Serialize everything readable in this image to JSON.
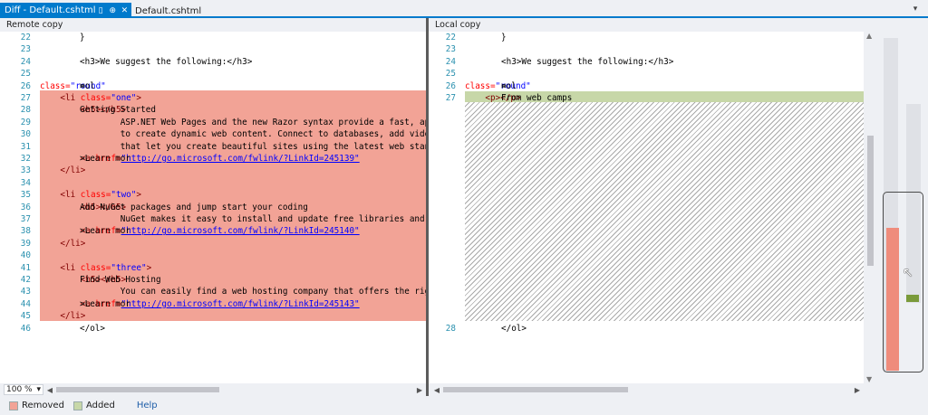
{
  "tabs": {
    "active": {
      "label": "Diff - Default.cshtml",
      "pin_icon": "pin-icon",
      "close_icon": "close-icon"
    },
    "inactive": {
      "label": "Default.cshtml"
    },
    "dropdown_icon": "chevron-down-icon"
  },
  "left_pane": {
    "header": "Remote copy",
    "lines": [
      {
        "n": "22",
        "segments": [
          [
            "}",
            "txt"
          ]
        ]
      },
      {
        "n": "23",
        "segments": []
      },
      {
        "n": "24",
        "segments": [
          [
            "<h3>We suggest the following:</h3>",
            "txt"
          ]
        ]
      },
      {
        "n": "25",
        "segments": []
      },
      {
        "n": "26",
        "segments": [
          [
            "<ol ",
            "txt"
          ],
          [
            "class=",
            "attr"
          ],
          [
            "\"round\"",
            "val"
          ],
          [
            ">",
            "txt"
          ]
        ]
      },
      {
        "n": "27",
        "segments": [
          [
            "    <li ",
            "tag"
          ],
          [
            "class=",
            "attr"
          ],
          [
            "\"one\"",
            "val"
          ],
          [
            ">",
            "tag"
          ]
        ]
      },
      {
        "n": "28",
        "segments": [
          [
            "        <h5>",
            "tag"
          ],
          [
            "Getting Started",
            "txt"
          ],
          [
            "</h5>",
            "tag"
          ]
        ]
      },
      {
        "n": "29",
        "segments": [
          [
            "        ASP.NET Web Pages and the new Razor syntax provide a fast, approa",
            "txt"
          ]
        ]
      },
      {
        "n": "30",
        "segments": [
          [
            "        to create dynamic web content. Connect to databases, add video, l",
            "txt"
          ]
        ]
      },
      {
        "n": "31",
        "segments": [
          [
            "        that let you create beautiful sites using the latest web standarc",
            "txt"
          ]
        ]
      },
      {
        "n": "32",
        "segments": [
          [
            "        <a ",
            "tag"
          ],
          [
            "href=",
            "attr"
          ],
          [
            "\"http://go.microsoft.com/fwlink/?LinkId=245139\"",
            "link"
          ],
          [
            ">Learn mor",
            "txt"
          ]
        ]
      },
      {
        "n": "33",
        "segments": [
          [
            "    </li>",
            "tag"
          ]
        ]
      },
      {
        "n": "34",
        "segments": []
      },
      {
        "n": "35",
        "segments": [
          [
            "    <li ",
            "tag"
          ],
          [
            "class=",
            "attr"
          ],
          [
            "\"two\"",
            "val"
          ],
          [
            ">",
            "tag"
          ]
        ]
      },
      {
        "n": "36",
        "segments": [
          [
            "        <h5>",
            "tag"
          ],
          [
            "Add NuGet packages and jump start your coding",
            "txt"
          ],
          [
            "</h5>",
            "tag"
          ]
        ]
      },
      {
        "n": "37",
        "segments": [
          [
            "        NuGet makes it easy to install and update free libraries and tool",
            "txt"
          ]
        ]
      },
      {
        "n": "38",
        "segments": [
          [
            "        <a ",
            "tag"
          ],
          [
            "href=",
            "attr"
          ],
          [
            "\"http://go.microsoft.com/fwlink/?LinkId=245140\"",
            "link"
          ],
          [
            ">Learn mor",
            "txt"
          ]
        ]
      },
      {
        "n": "39",
        "segments": [
          [
            "    </li>",
            "tag"
          ]
        ]
      },
      {
        "n": "40",
        "segments": []
      },
      {
        "n": "41",
        "segments": [
          [
            "    <li ",
            "tag"
          ],
          [
            "class=",
            "attr"
          ],
          [
            "\"three\"",
            "val"
          ],
          [
            ">",
            "tag"
          ]
        ]
      },
      {
        "n": "42",
        "segments": [
          [
            "        <h5>",
            "tag"
          ],
          [
            "Find Web Hosting",
            "txt"
          ],
          [
            "</h5>",
            "tag"
          ]
        ]
      },
      {
        "n": "43",
        "segments": [
          [
            "        You can easily find a web hosting company that offers the right m",
            "txt"
          ]
        ]
      },
      {
        "n": "44",
        "segments": [
          [
            "        <a ",
            "tag"
          ],
          [
            "href=",
            "attr"
          ],
          [
            "\"http://go.microsoft.com/fwlink/?LinkId=245143\"",
            "link"
          ],
          [
            ">Learn mor",
            "txt"
          ]
        ]
      },
      {
        "n": "45",
        "segments": [
          [
            "    </li>",
            "tag"
          ]
        ]
      },
      {
        "n": "46",
        "segments": [
          [
            "</ol>",
            "txt"
          ]
        ]
      }
    ]
  },
  "right_pane": {
    "header": "Local copy",
    "lines": [
      {
        "n": "22",
        "segments": [
          [
            "}",
            "txt"
          ]
        ]
      },
      {
        "n": "23",
        "segments": []
      },
      {
        "n": "24",
        "segments": [
          [
            "<h3>We suggest the following:</h3>",
            "txt"
          ]
        ]
      },
      {
        "n": "25",
        "segments": []
      },
      {
        "n": "26",
        "segments": [
          [
            "<ol ",
            "txt"
          ],
          [
            "class=",
            "attr"
          ],
          [
            "\"round\"",
            "val"
          ],
          [
            ">",
            "txt"
          ]
        ]
      },
      {
        "n": "27",
        "segments": [
          [
            "    <p>",
            "tag"
          ],
          [
            "From web camps",
            "txt"
          ],
          [
            "</p>",
            "tag"
          ]
        ]
      },
      {
        "n": "28",
        "segments": [
          [
            "</ol>",
            "txt"
          ]
        ]
      }
    ]
  },
  "status": {
    "zoom": "100 %",
    "zoom_icon": "chevron-down-icon"
  },
  "legend": {
    "removed": "Removed",
    "added": "Added",
    "help": "Help"
  },
  "colors": {
    "accent": "#007acc",
    "removed": "#f2a396",
    "added": "#c7d7a8",
    "linenum": "#2b91af"
  }
}
